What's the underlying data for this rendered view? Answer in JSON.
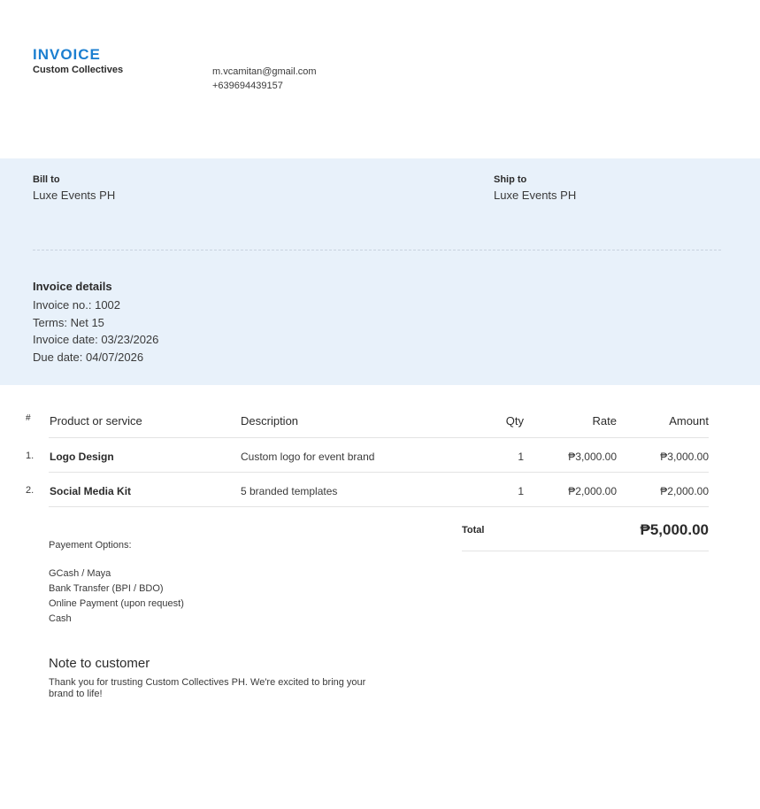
{
  "header": {
    "title": "INVOICE",
    "company": "Custom Collectives",
    "email": "m.vcamitan@gmail.com",
    "phone": "+639694439157"
  },
  "bill_to": {
    "label": "Bill to",
    "name": "Luxe Events PH"
  },
  "ship_to": {
    "label": "Ship to",
    "name": "Luxe Events PH"
  },
  "details": {
    "title": "Invoice details",
    "invoice_no": "Invoice no.: 1002",
    "terms": "Terms: Net 15",
    "invoice_date": "Invoice date: 03/23/2026",
    "due_date": "Due date: 04/07/2026"
  },
  "table": {
    "headers": {
      "num": "#",
      "product": "Product or service",
      "description": "Description",
      "qty": "Qty",
      "rate": "Rate",
      "amount": "Amount"
    },
    "rows": [
      {
        "num": "1.",
        "product": "Logo Design",
        "description": "Custom logo for event brand",
        "qty": "1",
        "rate": "₱3,000.00",
        "amount": "₱3,000.00"
      },
      {
        "num": "2.",
        "product": "Social Media Kit",
        "description": "5 branded templates",
        "qty": "1",
        "rate": "₱2,000.00",
        "amount": "₱2,000.00"
      }
    ]
  },
  "total": {
    "label": "Total",
    "value": "₱5,000.00"
  },
  "payment": {
    "title": "Payement Options:",
    "options": [
      "GCash / Maya",
      "Bank Transfer (BPI / BDO)",
      "Online Payment (upon request)",
      "Cash"
    ]
  },
  "note": {
    "title": "Note to customer",
    "text": "Thank you for trusting Custom Collectives PH. We're excited to bring your brand to life!"
  },
  "colors": {
    "accent": "#1c7fd0",
    "band": "#e8f1fa"
  }
}
